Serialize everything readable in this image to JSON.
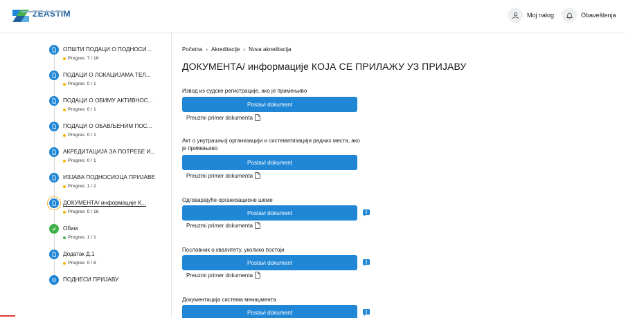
{
  "header": {
    "brand": "ZEASTIM",
    "account_label": "Moj nalog",
    "notifications_label": "Obaveštenja"
  },
  "sidebar": {
    "steps": [
      {
        "title": "ОПШТИ ПОДАЦИ О ПОДНОСИ...",
        "progress": "Progres: 7 / 16",
        "status": "in-progress"
      },
      {
        "title": "ПОДАЦИ О ЛОКАЦИЈАМА ТЕЛ...",
        "progress": "Progres: 0 / 1",
        "status": "in-progress"
      },
      {
        "title": "ПОДАЦИ О ОБИМУ АКТИВНОС...",
        "progress": "Progres: 0 / 1",
        "status": "in-progress"
      },
      {
        "title": "ПОДАЦИ О ОБАВЉЕНИМ ПОС...",
        "progress": "Progres: 0 / 1",
        "status": "in-progress"
      },
      {
        "title": "АКРЕДИТАЦИЈА ЗА ПОТРЕБЕ И...",
        "progress": "Progres: 0 / 1",
        "status": "in-progress"
      },
      {
        "title": "ИЗЈАВА ПОДНОСИОЦА ПРИЈАВЕ",
        "progress": "Progres: 1 / 2",
        "status": "in-progress"
      },
      {
        "title": "ДОКУМЕНТА/ информације К...",
        "progress": "Progres: 0 / 16",
        "status": "active"
      },
      {
        "title": "Обим",
        "progress": "Progres: 1 / 1",
        "status": "done"
      },
      {
        "title": "Додатак Д.1",
        "progress": "Progres: 0 / 8",
        "status": "in-progress"
      },
      {
        "title": "ПОДНЕСИ ПРИЈАВУ",
        "progress": "",
        "status": "submit"
      }
    ]
  },
  "breadcrumb": [
    "Početna",
    "Akreditacije",
    "Nova akreditacija"
  ],
  "page_title": "ДОКУМЕНТА/ информације КОЈА СЕ ПРИЛАЖУ УЗ ПРИЈАВУ",
  "documents": [
    {
      "label": "Извод из судске регистрације, ако је примењиво",
      "button": "Postavi dokument",
      "sample": "Preuzmi primer dokumenta",
      "warning": false
    },
    {
      "label": "Акт о унутрашњој организацији и систематизацији радних места, ако је примењиво",
      "button": "Postavi dokument",
      "sample": "Preuzmi primer dokumenta",
      "warning": false
    },
    {
      "label": "Одговарајуће организационе шеме",
      "button": "Postavi dokument",
      "sample": "Preuzmi primer dokumenta",
      "warning": true
    },
    {
      "label": "Пословник о квалитету, уколико постоји",
      "button": "Postavi dokument",
      "sample": "Preuzmi primer dokumenta",
      "warning": true
    },
    {
      "label": "Документација система менаџмента",
      "button": "Postavi dokument",
      "sample": "",
      "warning": true
    }
  ],
  "colors": {
    "primary": "#1f87d6",
    "progress_dot": "#f4b400",
    "done": "#3fb24a",
    "active_ring": "#f2b233"
  },
  "icons": {
    "step": "document-icon",
    "done": "check-icon",
    "submit": "list-icon",
    "account": "user-icon",
    "notifications": "bell-icon",
    "sample": "file-icon",
    "warning": "exclamation-icon"
  }
}
